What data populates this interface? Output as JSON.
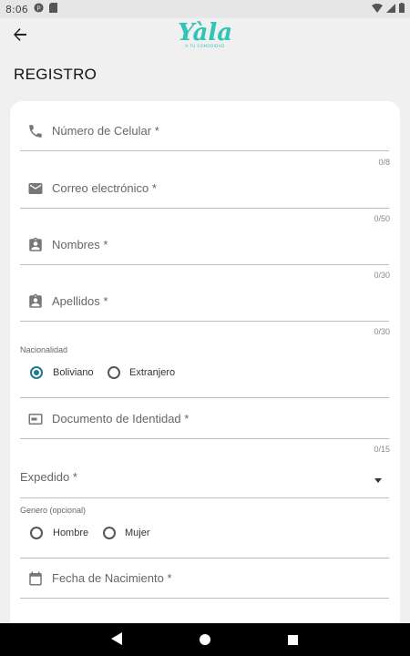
{
  "status_bar": {
    "time": "8:06",
    "icons": [
      "cast-icon",
      "sd-card-icon",
      "wifi-icon",
      "signal-icon",
      "battery-icon"
    ]
  },
  "app_bar": {
    "back_icon": "arrow-back-icon",
    "logo_text": "Yàla",
    "logo_tagline": "A TU COMODIDAD"
  },
  "page": {
    "title": "REGISTRO"
  },
  "form": {
    "phone": {
      "label": "Número de Celular *",
      "counter": "0/8",
      "icon": "phone-icon"
    },
    "email": {
      "label": "Correo electrónico *",
      "counter": "0/50",
      "icon": "email-icon"
    },
    "first_names": {
      "label": "Nombres *",
      "counter": "0/30",
      "icon": "contact-badge-icon"
    },
    "last_names": {
      "label": "Apellidos *",
      "counter": "0/30",
      "icon": "contact-badge-icon"
    },
    "nationality": {
      "label": "Nacionalidad",
      "options": [
        {
          "label": "Boliviano",
          "selected": true
        },
        {
          "label": "Extranjero",
          "selected": false
        }
      ]
    },
    "id_document": {
      "label": "Documento de Identidad *",
      "counter": "0/15",
      "icon": "id-card-icon"
    },
    "issued_in": {
      "label": "Expedido *",
      "icon": "dropdown-arrow-icon"
    },
    "gender": {
      "label": "Genero (opcional)",
      "options": [
        {
          "label": "Hombre",
          "selected": false
        },
        {
          "label": "Mujer",
          "selected": false
        }
      ]
    },
    "birth_date": {
      "label": "Fecha de Nacimiento *",
      "icon": "calendar-icon"
    }
  },
  "colors": {
    "accent": "#2ec4b6",
    "radio_selected": "#1f7a8c",
    "background": "#f0f0f0",
    "card": "#ffffff"
  },
  "nav_bar": {
    "buttons": [
      "back-triangle-icon",
      "home-circle-icon",
      "recents-square-icon"
    ]
  }
}
